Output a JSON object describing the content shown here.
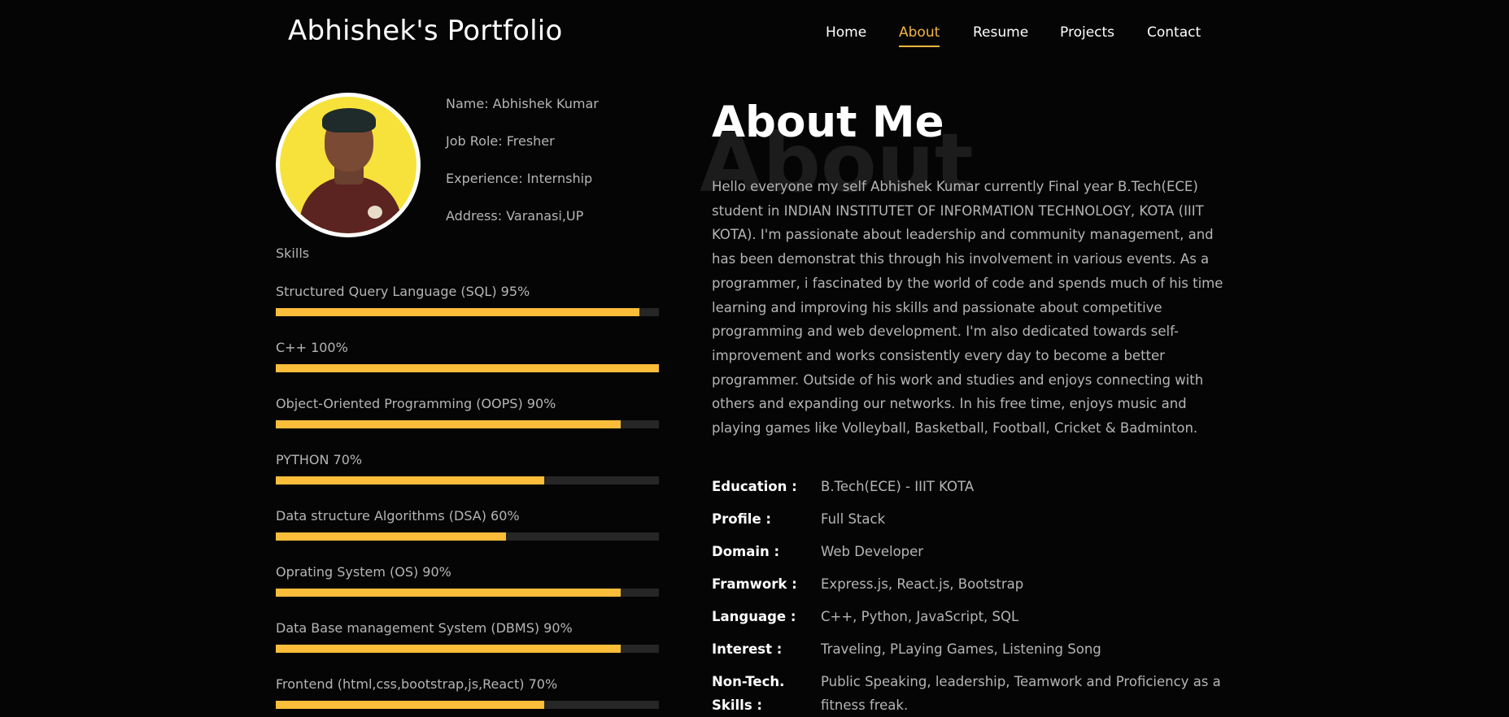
{
  "header": {
    "brand": "Abhishek's Portfolio"
  },
  "nav": {
    "items": [
      "Home",
      "About",
      "Resume",
      "Projects",
      "Contact"
    ],
    "active": "About"
  },
  "profile": {
    "name": "Name: Abhishek Kumar",
    "role": "Job Role: Fresher",
    "experience": "Experience: Internship",
    "address": "Address: Varanasi,UP"
  },
  "skills": {
    "title": "Skills",
    "items": [
      {
        "label": "Structured Query Language (SQL) 95%",
        "percent": 95
      },
      {
        "label": "C++ 100%",
        "percent": 100
      },
      {
        "label": "Object-Oriented Programming (OOPS) 90%",
        "percent": 90
      },
      {
        "label": "PYTHON 70%",
        "percent": 70
      },
      {
        "label": "Data structure Algorithms (DSA) 60%",
        "percent": 60
      },
      {
        "label": "Oprating System (OS) 90%",
        "percent": 90
      },
      {
        "label": "Data Base management System (DBMS) 90%",
        "percent": 90
      },
      {
        "label": "Frontend (html,css,bootstrap,js,React) 70%",
        "percent": 70
      }
    ]
  },
  "about": {
    "watermark": "About",
    "title": "About Me",
    "text": "Hello everyone my self Abhishek Kumar currently Final year B.Tech(ECE) student in INDIAN INSTITUTET OF INFORMATION TECHNOLOGY, KOTA (IIIT KOTA). I'm passionate about leadership and community management, and has been demonstrat this through his involvement in various events. As a programmer, i fascinated by the world of code and spends much of his time learning and improving his skills and passionate about competitive programming and web development. I'm also dedicated towards self-improvement and works consistently every day to become a better programmer. Outside of his work and studies and enjoys connecting with others and expanding our networks. In his free time, enjoys music and playing games like Volleyball, Basketball, Football, Cricket & Badminton."
  },
  "details": [
    {
      "key": "Education :",
      "value": "B.Tech(ECE) - IIIT KOTA"
    },
    {
      "key": "Profile :",
      "value": "Full Stack"
    },
    {
      "key": "Domain :",
      "value": "Web Developer"
    },
    {
      "key": "Framwork :",
      "value": "Express.js, React.js, Bootstrap"
    },
    {
      "key": "Language :",
      "value": "C++, Python, JavaScript, SQL"
    },
    {
      "key": "Interest :",
      "value": "Traveling, PLaying Games, Listening Song"
    },
    {
      "key": "Non-Tech. Skills :",
      "value": "Public Speaking, leadership, Teamwork and Proficiency as a fitness freak."
    }
  ],
  "colors": {
    "accent": "#fbbd3a",
    "background": "#050505",
    "track": "#262626",
    "text_muted": "#b5b5b5"
  }
}
